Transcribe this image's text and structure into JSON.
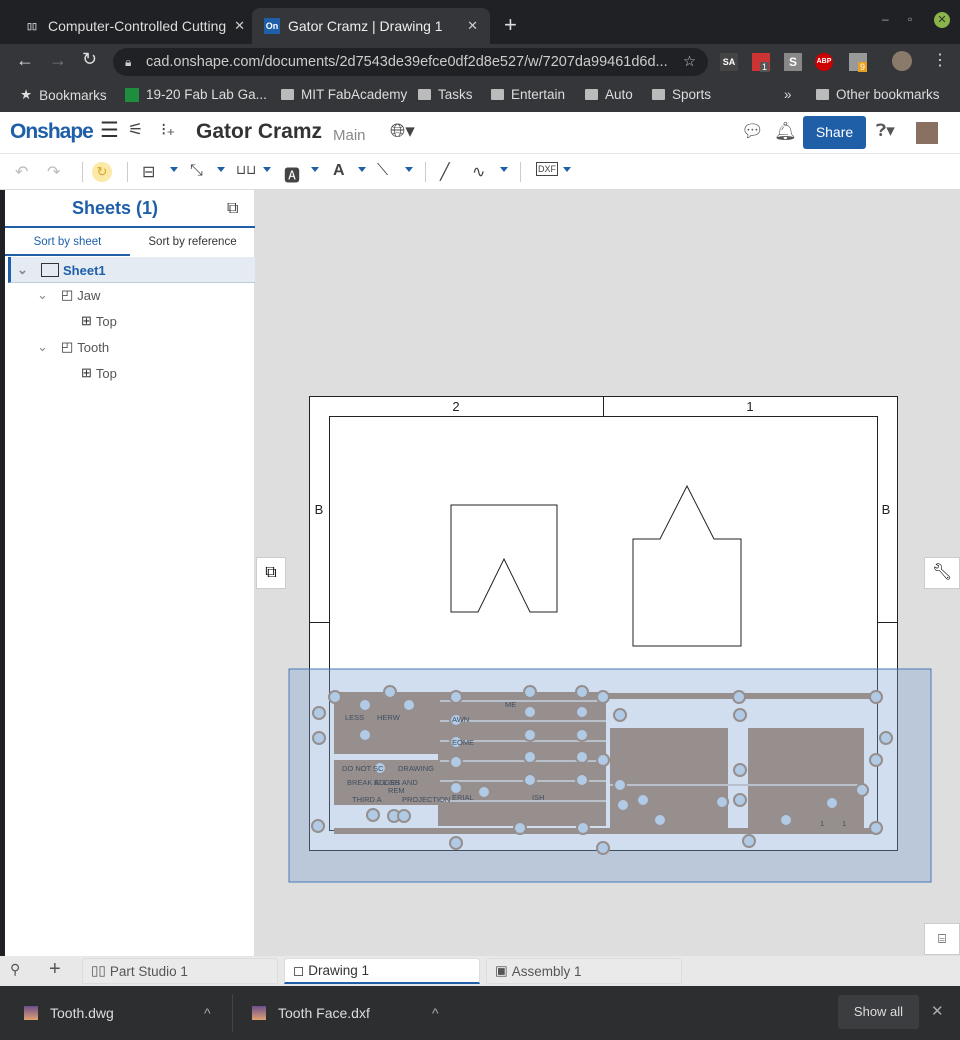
{
  "browser": {
    "tabs": [
      {
        "title": "Computer-Controlled Cutting",
        "favicon": "book-icon"
      },
      {
        "title": "Gator Cramz | Drawing 1",
        "favicon": "On"
      }
    ],
    "url": "cad.onshape.com/documents/2d7543de39efce0df2d8e527/w/7207da99461d6d...",
    "extensions": [
      "SA",
      "1",
      "S",
      "ABP",
      "9"
    ],
    "bookmarks": [
      "Bookmarks",
      "19-20 Fab Lab Ga...",
      "MIT FabAcademy",
      "Tasks",
      "Entertain",
      "Auto",
      "Sports"
    ],
    "other_bookmarks": "Other bookmarks",
    "overflow": "»"
  },
  "app": {
    "logo": "Onshape",
    "doc_title": "Gator Cramz",
    "branch": "Main",
    "share": "Share",
    "accent": "#1e5fa8"
  },
  "sidebar": {
    "title": "Sheets (1)",
    "tabs": [
      "Sort by sheet",
      "Sort by reference"
    ],
    "tree": [
      {
        "label": "Sheet1",
        "level": 0,
        "selected": true
      },
      {
        "label": "Jaw",
        "level": 1
      },
      {
        "label": "Top",
        "level": 2
      },
      {
        "label": "Tooth",
        "level": 1
      },
      {
        "label": "Top",
        "level": 2
      }
    ]
  },
  "drawing": {
    "zones_top": [
      "2",
      "1"
    ],
    "zones_side": [
      "B",
      "B"
    ],
    "title_block_text": [
      "DO NOT SC",
      "DRAWING",
      "BREAK ALL SH",
      "EDGES AND",
      "REM",
      "URRS",
      "THIRD A",
      "PROJECTION",
      "LESS",
      "HERW",
      "SPECIFIED",
      "ME",
      "AWN",
      "EOME",
      "ERIAL",
      "ISH",
      "1",
      "1"
    ],
    "title_block_color": "#a6866a"
  },
  "doc_tabs": [
    {
      "label": "Part Studio 1"
    },
    {
      "label": "Drawing 1",
      "active": true
    },
    {
      "label": "Assembly 1"
    }
  ],
  "downloads": {
    "files": [
      "Tooth.dwg",
      "Tooth Face.dxf"
    ],
    "show_all": "Show all"
  }
}
